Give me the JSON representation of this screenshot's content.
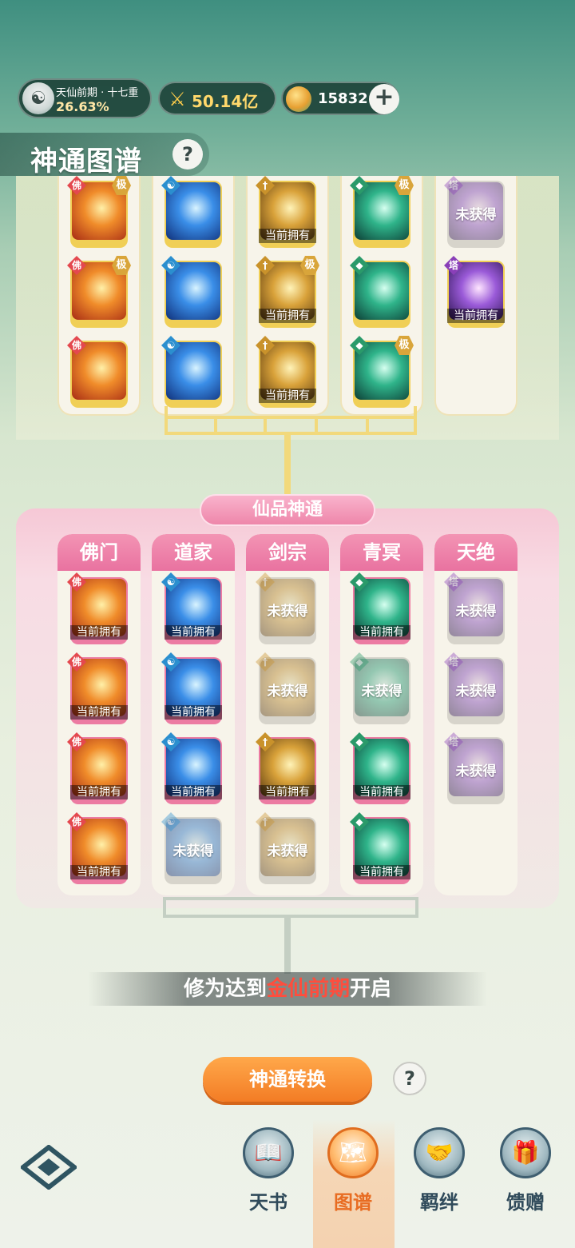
{
  "header": {
    "realm_name": "天仙前期 · 十七重",
    "realm_progress": "26.63%",
    "power": "50.14亿",
    "currency": "15832",
    "plus_icon": "plus-icon"
  },
  "page_title": "神通图谱",
  "help_icon": "?",
  "badges": {
    "ji": "极",
    "owned": "当前拥有",
    "missing": "未获得"
  },
  "upper_columns": [
    {
      "sect_icon": "buddha-icon",
      "color": "#e4484f",
      "cards": [
        {
          "state": "none",
          "ji": true
        },
        {
          "state": "none",
          "ji": true
        },
        {
          "state": "none",
          "ji": false
        }
      ]
    },
    {
      "sect_icon": "taiji-icon",
      "color": "#2b8fcf",
      "cards": [
        {
          "state": "none",
          "ji": false
        },
        {
          "state": "none",
          "ji": false
        },
        {
          "state": "none",
          "ji": false
        }
      ]
    },
    {
      "sect_icon": "sword-icon",
      "color": "#c9922b",
      "cards": [
        {
          "state": "owned",
          "ji": false
        },
        {
          "state": "owned",
          "ji": true
        },
        {
          "state": "owned",
          "ji": false
        }
      ]
    },
    {
      "sect_icon": "leaf-icon",
      "color": "#2a9a6a",
      "cards": [
        {
          "state": "none",
          "ji": true
        },
        {
          "state": "none",
          "ji": false
        },
        {
          "state": "none",
          "ji": true
        }
      ]
    },
    {
      "sect_icon": "pagoda-icon",
      "color": "#8a3fb8",
      "cards": [
        {
          "state": "missing",
          "ji": false
        },
        {
          "state": "owned",
          "ji": false
        }
      ]
    }
  ],
  "lower_section_title": "仙品神通",
  "lower_columns": [
    {
      "name": "佛门",
      "sect_icon": "buddha-icon",
      "color": "#e4484f",
      "cards": [
        "owned",
        "owned",
        "owned",
        "owned"
      ]
    },
    {
      "name": "道家",
      "sect_icon": "taiji-icon",
      "color": "#2b8fcf",
      "cards": [
        "owned",
        "owned",
        "owned",
        "missing"
      ]
    },
    {
      "name": "剑宗",
      "sect_icon": "sword-icon",
      "color": "#c9922b",
      "cards": [
        "missing",
        "missing",
        "owned",
        "missing"
      ]
    },
    {
      "name": "青冥",
      "sect_icon": "leaf-icon",
      "color": "#2a9a6a",
      "cards": [
        "owned",
        "missing",
        "owned",
        "owned"
      ]
    },
    {
      "name": "天绝",
      "sect_icon": "pagoda-icon",
      "color": "#8a3fb8",
      "cards": [
        "missing",
        "missing",
        "missing"
      ]
    }
  ],
  "unlock_message": {
    "prefix": "修为达到",
    "highlight": "金仙前期",
    "suffix": "开启"
  },
  "convert_button": "神通转换",
  "nav": {
    "menu_icon": "menu-diamond-icon",
    "items": [
      {
        "label": "天书",
        "icon": "book-icon",
        "active": false
      },
      {
        "label": "图谱",
        "icon": "map-icon",
        "active": true
      },
      {
        "label": "羁绊",
        "icon": "handshake-icon",
        "active": false
      },
      {
        "label": "馈赠",
        "icon": "gift-bag-icon",
        "active": false
      }
    ]
  }
}
